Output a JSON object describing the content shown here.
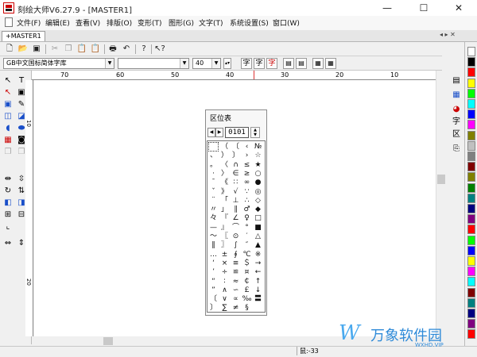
{
  "window": {
    "title": "刻绘大师V6.27.9 - [MASTER1]",
    "minimize": "—",
    "maximize": "☐",
    "close": "✕"
  },
  "menu": [
    "文件(F)",
    "编辑(E)",
    "查看(V)",
    "排版(O)",
    "变形(T)",
    "图形(G)",
    "文字(T)",
    "系统设置(S)",
    "窗口(W)"
  ],
  "tab": {
    "label": "+MASTER1",
    "nav": "◂ ▸ ✕"
  },
  "toolbar1": {
    "icons": [
      "new-file-icon",
      "open-folder-icon",
      "save-icon",
      "cut-icon",
      "copy-icon",
      "paste-icon",
      "paste-special-icon",
      "print-icon",
      "print-preview-icon",
      "undo-icon",
      "help-icon",
      "context-help-icon"
    ]
  },
  "toolbar2": {
    "font_combo": "GB中文国标简体字库",
    "font_combo2": "",
    "size_combo": "40",
    "buttons": [
      "字",
      "字",
      "字"
    ]
  },
  "hruler": {
    "labels": [
      "70",
      "60",
      "50",
      "40",
      "30",
      "20",
      "10"
    ]
  },
  "vruler": {
    "labels": [
      "10",
      "20"
    ]
  },
  "status": {
    "coord": "鼠:-33"
  },
  "zone_table": {
    "title": "区位表",
    "code": "0101",
    "rows": [
      [
        "",
        "（",
        "〔",
        "‹",
        "№"
      ],
      [
        "、",
        "）",
        "〕",
        "›",
        "☆"
      ],
      [
        "。",
        "〈",
        "∩",
        "≤",
        "★"
      ],
      [
        "·",
        "〉",
        "∈",
        "≥",
        "○"
      ],
      [
        "ˉ",
        "《",
        "∷",
        "∞",
        "●"
      ],
      [
        "ˇ",
        "》",
        "√",
        "∵",
        "◎"
      ],
      [
        "¨",
        "「",
        "⊥",
        "∴",
        "◇"
      ],
      [
        "〃",
        "」",
        "∥",
        "♂",
        "◆"
      ],
      [
        "々",
        "『",
        "∠",
        "♀",
        "□"
      ],
      [
        "—",
        "』",
        "⌒",
        "°",
        "■"
      ],
      [
        "～",
        "〖",
        "⊙",
        "′",
        "△"
      ],
      [
        "‖",
        "〗",
        "∫",
        "″",
        "▲"
      ],
      [
        "…",
        "±",
        "∮",
        "℃",
        "※"
      ],
      [
        "‘",
        "×",
        "≡",
        "＄",
        "→"
      ],
      [
        "’",
        "÷",
        "≌",
        "¤",
        "←"
      ],
      [
        "“",
        "∶",
        "≈",
        "￠",
        "↑"
      ],
      [
        "”",
        "∧",
        "∽",
        "￡",
        "↓"
      ],
      [
        "〔",
        "∨",
        "∝",
        "‰",
        "〓"
      ],
      [
        "〕",
        "∑",
        "≠",
        "§",
        ""
      ]
    ]
  },
  "palette": [
    "#ffffff",
    "#000000",
    "#ff0000",
    "#ffff00",
    "#00ff00",
    "#00ffff",
    "#0000ff",
    "#ff00ff",
    "#808000",
    "#c0c0c0",
    "#808080",
    "#800000",
    "#808000",
    "#008000",
    "#008080",
    "#000080",
    "#800080",
    "#ff0000",
    "#00ff00",
    "#0000ff",
    "#ffff00",
    "#ff00ff",
    "#00ffff",
    "#800000",
    "#008080",
    "#000080",
    "#800080",
    "#ff0000"
  ],
  "side_tools": [
    "layer-icon",
    "node-icon",
    "color-icon",
    "字",
    "区",
    "export-icon"
  ],
  "watermark": {
    "logo": "W",
    "name": "万象软件园",
    "url": "WXHD.VIP"
  }
}
